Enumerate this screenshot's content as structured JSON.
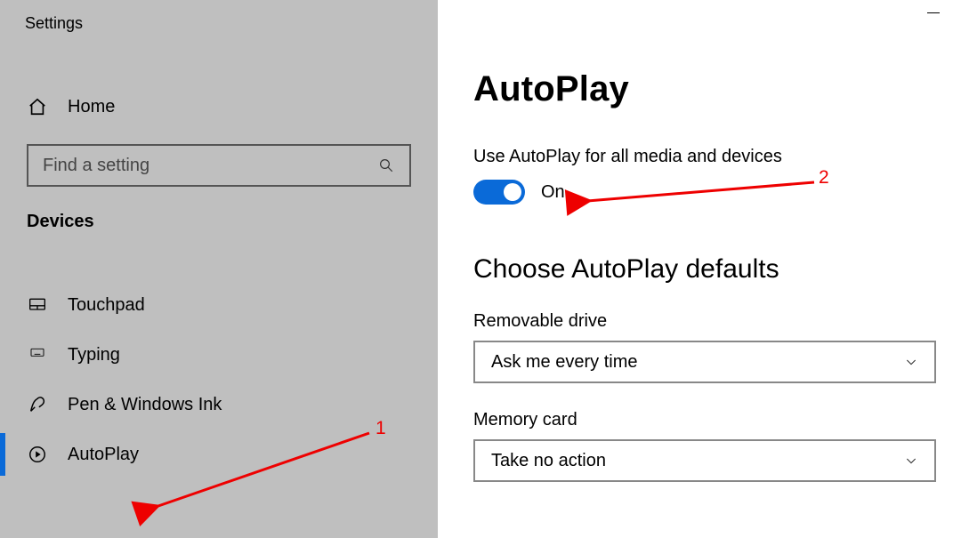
{
  "app_title": "Settings",
  "sidebar": {
    "home_label": "Home",
    "search_placeholder": "Find a setting",
    "section_label": "Devices",
    "items": [
      {
        "label": "Touchpad",
        "icon": "touchpad-icon",
        "selected": false
      },
      {
        "label": "Typing",
        "icon": "keyboard-icon",
        "selected": false
      },
      {
        "label": "Pen & Windows Ink",
        "icon": "pen-icon",
        "selected": false
      },
      {
        "label": "AutoPlay",
        "icon": "autoplay-icon",
        "selected": true
      }
    ]
  },
  "page": {
    "title": "AutoPlay",
    "toggle_label": "Use AutoPlay for all media and devices",
    "toggle_state": "On",
    "defaults_heading": "Choose AutoPlay defaults",
    "fields": [
      {
        "label": "Removable drive",
        "value": "Ask me every time"
      },
      {
        "label": "Memory card",
        "value": "Take no action"
      }
    ]
  },
  "annotations": {
    "label1": "1",
    "label2": "2"
  },
  "colors": {
    "accent": "#0a6ad8",
    "annotation": "#ee0000",
    "sidebar_bg": "#bfbfbf"
  }
}
